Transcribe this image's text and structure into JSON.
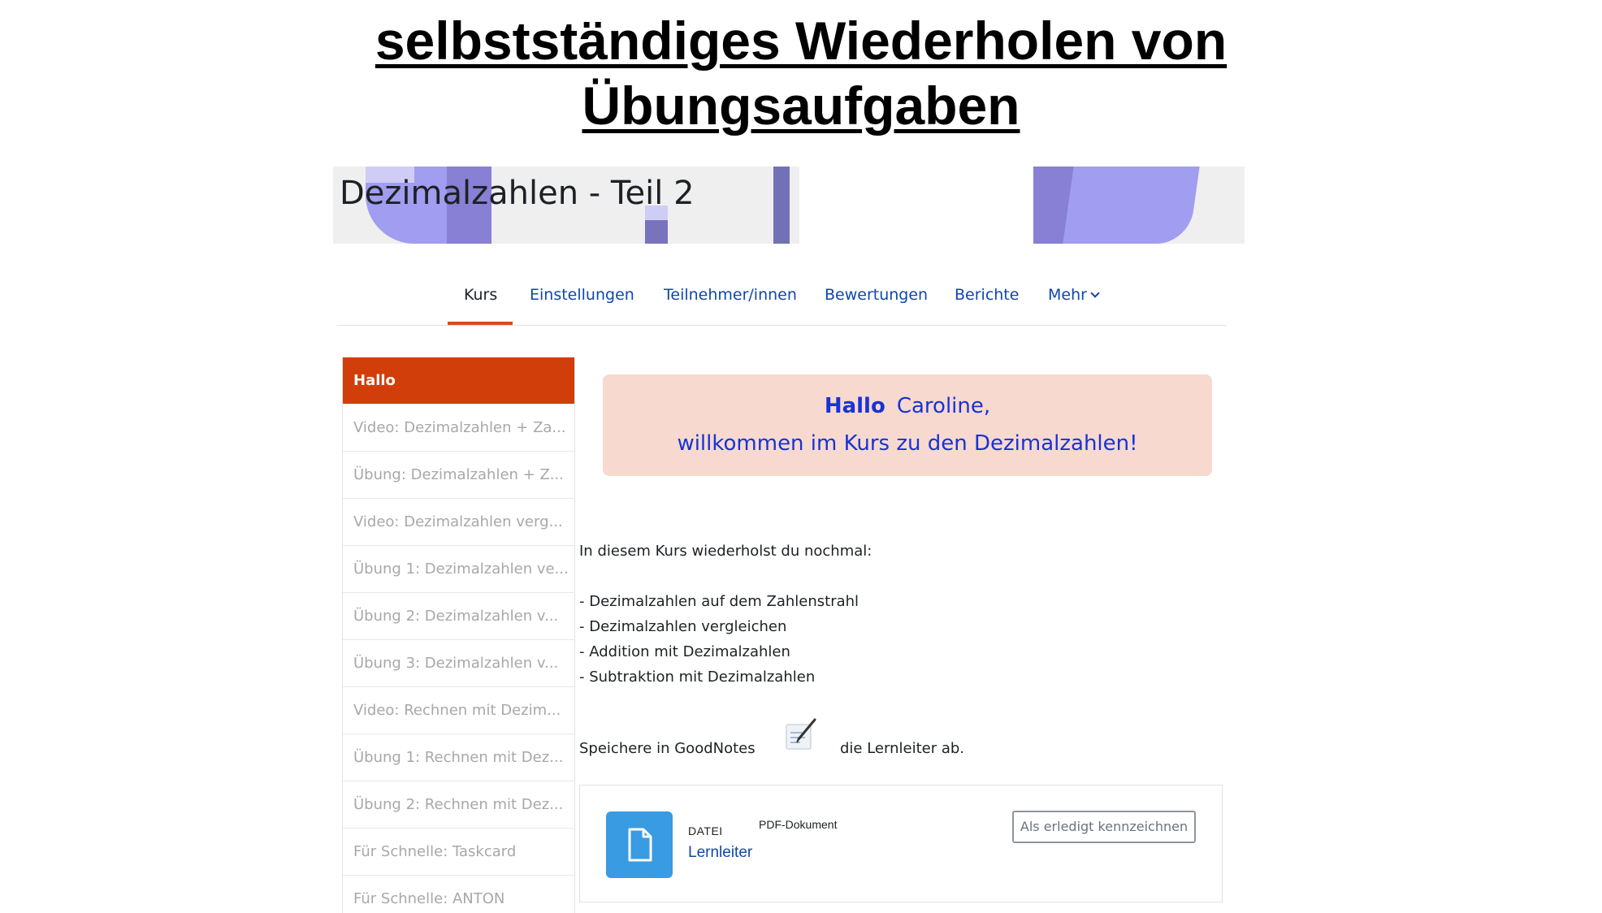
{
  "slide": {
    "title_line1": "selbstständiges Wiederholen von",
    "title_line2": "Übungsaufgaben"
  },
  "course": {
    "title": "Dezimalzahlen - Teil 2"
  },
  "nav": {
    "items": [
      "Kurs",
      "Einstellungen",
      "Teilnehmer/innen",
      "Bewertungen",
      "Berichte",
      "Mehr"
    ],
    "active": "Kurs"
  },
  "sidebar": {
    "items": [
      "Hallo",
      "Video: Dezimalzahlen + Za...",
      "Übung: Dezimalzahlen + Z...",
      "Video: Dezimalzahlen verg...",
      "Übung 1: Dezimalzahlen ve...",
      "Übung 2: Dezimalzahlen v...",
      "Übung 3: Dezimalzahlen v...",
      "Video: Rechnen mit Dezim...",
      "Übung 1: Rechnen mit Dez...",
      "Übung 2: Rechnen mit Dez...",
      "Für Schnelle: Taskcard",
      "Für Schnelle: ANTON"
    ]
  },
  "greeting": {
    "hello": "Hallo",
    "name": "Caroline,",
    "welcome": "willkommen im Kurs zu den Dezimalzahlen!"
  },
  "content": {
    "intro": "In diesem Kurs wiederholst du nochmal:",
    "topics": [
      "- Dezimalzahlen auf dem Zahlenstrahl",
      "- Dezimalzahlen vergleichen",
      "- Addition mit Dezimalzahlen",
      "- Subtraktion mit Dezimalzahlen"
    ],
    "save_before": "Speichere in GoodNotes",
    "save_after": "die Lernleiter ab."
  },
  "activity": {
    "type": "DATEI",
    "subtype": "PDF-Dokument",
    "name": "Lernleiter",
    "mark_done": "Als erledigt kennzeichnen"
  },
  "colors": {
    "accent": "#d13e0a",
    "link": "#0f47ad",
    "greeting_bg": "#f7d9cf",
    "greeting_text": "#1733d6",
    "file_icon": "#399be2"
  },
  "icons": {
    "note": "notepad-pen-icon",
    "file": "file-icon",
    "chevron": "chevron-down-icon"
  }
}
